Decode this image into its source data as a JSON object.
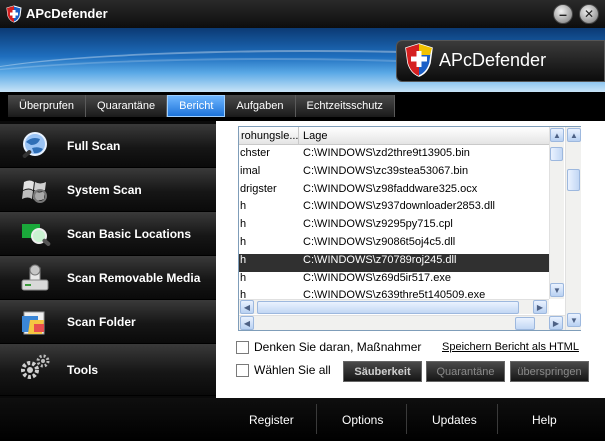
{
  "window": {
    "title": "APcDefender",
    "minimize": "–",
    "close": "✕"
  },
  "brand": {
    "name": "APcDefender"
  },
  "tabs": [
    {
      "label": "Überprufen"
    },
    {
      "label": "Quarantäne"
    },
    {
      "label": "Bericht",
      "active": true
    },
    {
      "label": "Aufgaben"
    },
    {
      "label": "Echtzeitsschutz"
    }
  ],
  "sidebar": {
    "items": [
      {
        "label": "Full Scan",
        "icon": "globe-magnifier-icon"
      },
      {
        "label": "System Scan",
        "icon": "windows-flag-icon"
      },
      {
        "label": "Scan Basic Locations",
        "icon": "green-magnifier-icon"
      },
      {
        "label": "Scan Removable Media",
        "icon": "usb-drive-icon"
      },
      {
        "label": "Scan Folder",
        "icon": "folder-icon"
      },
      {
        "label": "Tools",
        "icon": "gears-icon"
      }
    ]
  },
  "report": {
    "columns": [
      "rohungsle...",
      "Lage"
    ],
    "rows": [
      {
        "threat": "chster",
        "location": "C:\\WINDOWS\\zd2thre9t13905.bin"
      },
      {
        "threat": "imal",
        "location": "C:\\WINDOWS\\zc39stea53067.bin"
      },
      {
        "threat": "drigster",
        "location": "C:\\WINDOWS\\z98faddware325.ocx"
      },
      {
        "threat": "h",
        "location": "C:\\WINDOWS\\z937downloader2853.dll"
      },
      {
        "threat": "h",
        "location": "C:\\WINDOWS\\z9295py715.cpl"
      },
      {
        "threat": "h",
        "location": "C:\\WINDOWS\\z9086t5oj4c5.dll"
      },
      {
        "threat": "h",
        "location": "C:\\WINDOWS\\z70789roj245.dll",
        "selected": true
      },
      {
        "threat": "h",
        "location": "C:\\WINDOWS\\z69d5ir517.exe"
      },
      {
        "threat": "h",
        "location": "C:\\WINDOWS\\z639thre5t140509.exe"
      }
    ]
  },
  "options": {
    "remember": "Denken Sie daran, Maßnahmer",
    "select_all": "Wählen Sie all",
    "save_report": "Speichern Bericht als HTML"
  },
  "buttons": {
    "clean": "Säuberkeit",
    "quarantine": "Quarantäne",
    "skip": "überspringen"
  },
  "footer": [
    "Register",
    "Options",
    "Updates",
    "Help"
  ],
  "colors": {
    "selected_tab": "#2f8cff",
    "selected_row": "#303030",
    "banner_dark": "#0b3a74",
    "banner_light": "#c8e4f7"
  }
}
